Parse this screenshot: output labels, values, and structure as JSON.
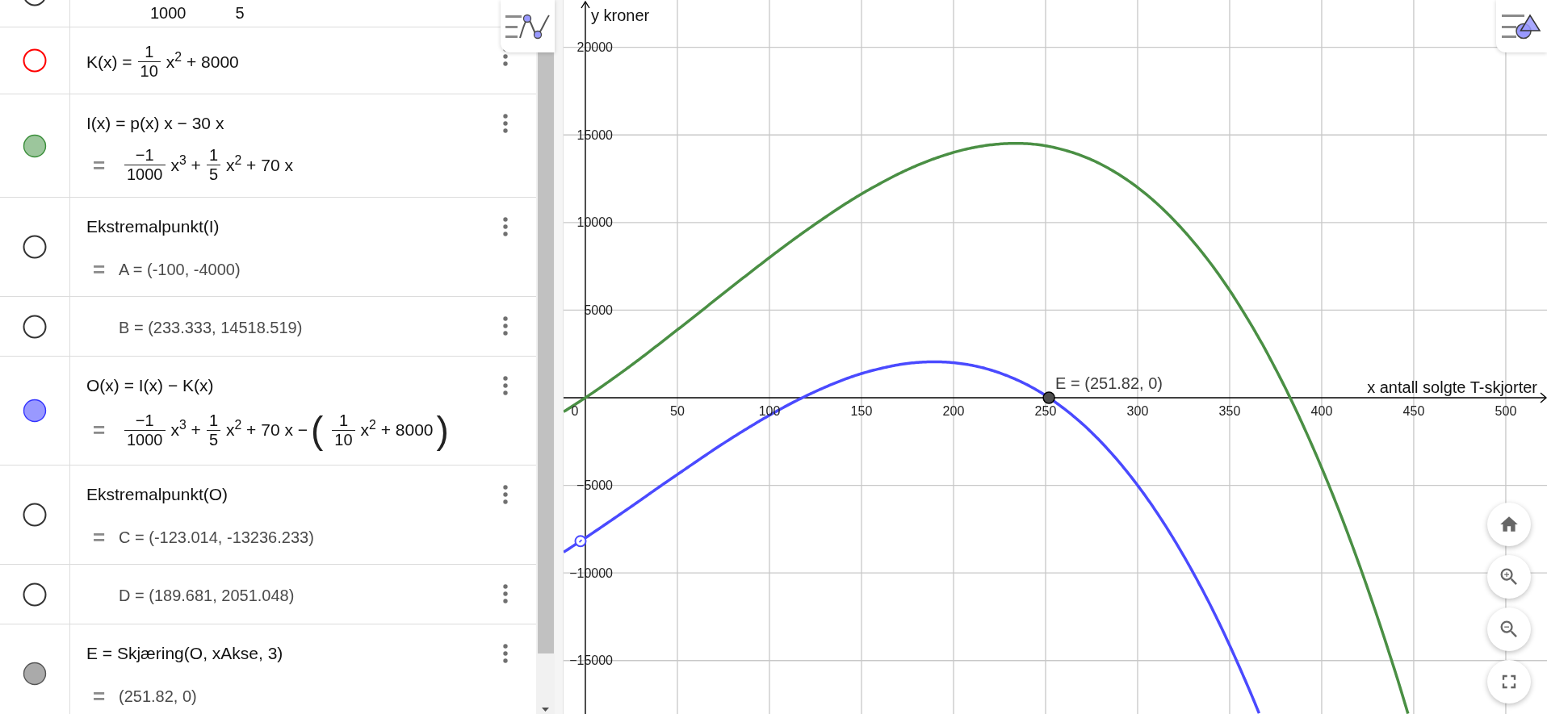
{
  "algebra_view": {
    "rows": [
      {
        "visible": false,
        "color": "#333333",
        "menu": false,
        "lines": [
          {
            "kind": "cut",
            "parts": [
              {
                "kind": "den",
                "text": "1000"
              },
              {
                "kind": "den",
                "text": "5"
              }
            ]
          }
        ]
      },
      {
        "visible": false,
        "color": "#ff0000",
        "menu": true,
        "lines": [
          {
            "kind": "input",
            "parts": [
              {
                "kind": "text",
                "text": "K(x) ="
              },
              {
                "kind": "frac",
                "num": "1",
                "den": "10"
              },
              {
                "kind": "text",
                "text": "x$^{2}$ + 8000"
              }
            ]
          }
        ]
      },
      {
        "visible": true,
        "color": "#9cc69c",
        "menu": true,
        "lines": [
          {
            "kind": "input",
            "parts": [
              {
                "kind": "text",
                "text": "I(x) = p(x) x − 30 x"
              }
            ]
          },
          {
            "kind": "output",
            "marker": "=",
            "parts": [
              {
                "kind": "frac",
                "num": "−1",
                "den": "1000"
              },
              {
                "kind": "text",
                "text": "x$^{3}$ +"
              },
              {
                "kind": "frac",
                "num": "1",
                "den": "5"
              },
              {
                "kind": "text",
                "text": "x$^{2}$ + 70 x"
              }
            ]
          }
        ]
      },
      {
        "visible": false,
        "color": "#333333",
        "menu": true,
        "lines": [
          {
            "kind": "input",
            "parts": [
              {
                "kind": "text",
                "text": "Ekstremalpunkt(I)"
              }
            ]
          },
          {
            "kind": "output",
            "marker": "=",
            "parts": [
              {
                "kind": "value",
                "text": "A = (-100, -4000)"
              }
            ]
          }
        ]
      },
      {
        "visible": false,
        "color": "#333333",
        "menu": true,
        "lines": [
          {
            "kind": "output",
            "parts": [
              {
                "kind": "value",
                "text": "B = (233.333, 14518.519)"
              }
            ]
          }
        ]
      },
      {
        "visible": true,
        "color": "#9999ff",
        "menu": true,
        "lines": [
          {
            "kind": "input",
            "parts": [
              {
                "kind": "text",
                "text": "O(x) = I(x) − K(x)"
              }
            ]
          },
          {
            "kind": "output",
            "marker": "=",
            "parts": [
              {
                "kind": "frac",
                "num": "−1",
                "den": "1000"
              },
              {
                "kind": "text",
                "text": "x$^{3}$ +"
              },
              {
                "kind": "frac",
                "num": "1",
                "den": "5"
              },
              {
                "kind": "text",
                "text": "x$^{2}$ + 70 x −"
              },
              {
                "kind": "paren",
                "text": "("
              },
              {
                "kind": "frac",
                "num": "1",
                "den": "10"
              },
              {
                "kind": "text",
                "text": "x$^{2}$ + 8000"
              },
              {
                "kind": "paren",
                "text": ")"
              }
            ]
          }
        ]
      },
      {
        "visible": false,
        "color": "#333333",
        "menu": true,
        "lines": [
          {
            "kind": "input",
            "parts": [
              {
                "kind": "text",
                "text": "Ekstremalpunkt(O)"
              }
            ]
          },
          {
            "kind": "output",
            "marker": "=",
            "parts": [
              {
                "kind": "value",
                "text": "C = (-123.014, -13236.233)"
              }
            ]
          }
        ]
      },
      {
        "visible": false,
        "color": "#333333",
        "menu": true,
        "lines": [
          {
            "kind": "output",
            "parts": [
              {
                "kind": "value",
                "text": "D = (189.681, 2051.048)"
              }
            ]
          }
        ]
      },
      {
        "visible": true,
        "color": "#aaaaaa",
        "menu": true,
        "lines": [
          {
            "kind": "input",
            "parts": [
              {
                "kind": "text",
                "text": "E = Skjæring(O, xAkse, 3)"
              }
            ]
          },
          {
            "kind": "output",
            "marker": "=",
            "parts": [
              {
                "kind": "value",
                "text": "(251.82, 0)"
              }
            ]
          }
        ]
      }
    ]
  },
  "graphics_view": {
    "origin_label": "0",
    "chart_data": {
      "type": "line",
      "xlabel": "x antall solgte T-skjorter",
      "ylabel": "y kroner",
      "grid": true,
      "x": [
        -11.8,
        -10,
        0,
        10,
        20,
        30,
        40,
        50,
        60,
        70,
        80,
        90,
        100,
        110,
        120,
        130,
        140,
        150,
        160,
        170,
        180,
        190,
        200,
        210,
        220,
        230,
        240,
        250,
        260,
        270,
        280,
        290,
        300,
        310,
        320,
        330,
        340,
        350,
        360,
        366,
        370,
        380,
        390,
        400,
        410,
        420,
        430,
        440,
        446.9
      ],
      "series": [
        {
          "color": "#4a8f44",
          "values": [
            -800,
            -680,
            0,
            720,
            1470,
            2250,
            3060,
            3880,
            4700,
            5540,
            6370,
            7190,
            8000,
            8790,
            9550,
            10280,
            10980,
            11630,
            12220,
            12770,
            13250,
            13660,
            14000,
            14260,
            14430,
            14510,
            14500,
            14380,
            14140,
            13800,
            13330,
            12730,
            12000,
            11130,
            10110,
            8940,
            7620,
            6130,
            4460,
            3380,
            2630,
            610,
            -1600,
            -4000,
            -6600,
            -9410,
            -12430,
            -15660,
            -18030
          ]
        },
        {
          "color": "#4a4aff",
          "values": [
            -8810,
            -8690,
            -8000,
            -7290,
            -6570,
            -5840,
            -5100,
            -4380,
            -3660,
            -2950,
            -2270,
            -1620,
            -1000,
            -420,
            110,
            590,
            1020,
            1380,
            1660,
            1880,
            2010,
            2050,
            2000,
            1850,
            1590,
            1220,
            740,
            130,
            -620,
            -1490,
            -2510,
            -3680,
            -5000,
            -6480,
            -8130,
            -9950,
            -11940,
            -14130,
            -16500,
            -18010,
            null,
            null,
            null,
            null,
            null,
            null,
            null,
            null,
            null
          ]
        }
      ],
      "xlim": [
        -11.84,
        522.4
      ],
      "ylim": [
        -18050,
        22700
      ],
      "xticks": [
        50,
        100,
        150,
        200,
        250,
        300,
        350,
        400,
        450,
        500
      ],
      "yticks": [
        {
          "value": -15000,
          "label": "−15000"
        },
        {
          "value": -10000,
          "label": "−10000"
        },
        {
          "value": -5000,
          "label": "−5000"
        },
        5000,
        10000,
        15000,
        20000
      ],
      "annotations": [
        {
          "x": 251.82,
          "y": 0,
          "text": "E = (251.82, 0)"
        }
      ]
    }
  }
}
